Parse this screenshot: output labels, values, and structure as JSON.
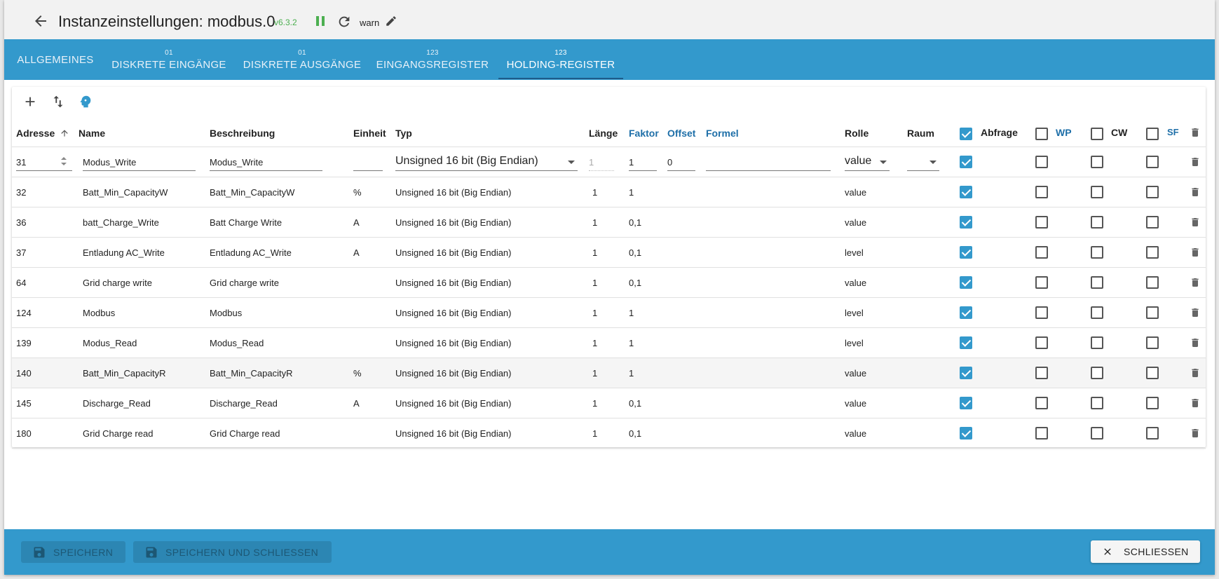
{
  "header": {
    "title": "Instanzeinstellungen: modbus.0",
    "version": "v6.3.2",
    "log_level": "warn"
  },
  "tabs": [
    {
      "sup": "",
      "label": "ALLGEMEINES"
    },
    {
      "sup": "01",
      "label": "DISKRETE EINGÄNGE"
    },
    {
      "sup": "01",
      "label": "DISKRETE AUSGÄNGE"
    },
    {
      "sup": "123",
      "label": "EINGANGSREGISTER"
    },
    {
      "sup": "123",
      "label": "HOLDING-REGISTER"
    }
  ],
  "active_tab": "HOLDING-REGISTER",
  "columns": {
    "address": "Adresse",
    "name": "Name",
    "description": "Beschreibung",
    "unit": "Einheit",
    "type": "Typ",
    "length": "Länge",
    "factor": "Faktor",
    "offset": "Offset",
    "formula": "Formel",
    "role": "Rolle",
    "room": "Raum",
    "poll": "Abfrage",
    "wp": "WP",
    "cw": "CW",
    "sf": "SF"
  },
  "edit_row": {
    "address": "31",
    "name": "Modus_Write",
    "description": "Modus_Write",
    "unit": "",
    "type": "Unsigned 16 bit (Big Endian)",
    "length": "1",
    "factor": "1",
    "offset": "0",
    "formula": "",
    "role": "value",
    "room": "",
    "poll": true,
    "wp": false,
    "cw": false,
    "sf": false
  },
  "rows": [
    {
      "address": "32",
      "name": "Batt_Min_CapacityW",
      "description": "Batt_Min_CapacityW",
      "unit": "%",
      "type": "Unsigned 16 bit (Big Endian)",
      "length": "1",
      "factor": "1",
      "role": "value",
      "poll": true,
      "wp": false,
      "cw": false,
      "sf": false
    },
    {
      "address": "36",
      "name": "batt_Charge_Write",
      "description": "Batt Charge Write",
      "unit": "A",
      "type": "Unsigned 16 bit (Big Endian)",
      "length": "1",
      "factor": "0,1",
      "role": "value",
      "poll": true,
      "wp": false,
      "cw": false,
      "sf": false
    },
    {
      "address": "37",
      "name": "Entladung AC_Write",
      "description": "Entladung AC_Write",
      "unit": "A",
      "type": "Unsigned 16 bit (Big Endian)",
      "length": "1",
      "factor": "0,1",
      "role": "level",
      "poll": true,
      "wp": false,
      "cw": false,
      "sf": false
    },
    {
      "address": "64",
      "name": "Grid charge write",
      "description": "Grid charge write",
      "unit": "",
      "type": "Unsigned 16 bit (Big Endian)",
      "length": "1",
      "factor": "0,1",
      "role": "value",
      "poll": true,
      "wp": false,
      "cw": false,
      "sf": false
    },
    {
      "address": "124",
      "name": "Modbus",
      "description": "Modbus",
      "unit": "",
      "type": "Unsigned 16 bit (Big Endian)",
      "length": "1",
      "factor": "1",
      "role": "level",
      "poll": true,
      "wp": false,
      "cw": false,
      "sf": false
    },
    {
      "address": "139",
      "name": "Modus_Read",
      "description": "Modus_Read",
      "unit": "",
      "type": "Unsigned 16 bit (Big Endian)",
      "length": "1",
      "factor": "1",
      "role": "level",
      "poll": true,
      "wp": false,
      "cw": false,
      "sf": false
    },
    {
      "address": "140",
      "name": "Batt_Min_CapacityR",
      "description": "Batt_Min_CapacityR",
      "unit": "%",
      "type": "Unsigned 16 bit (Big Endian)",
      "length": "1",
      "factor": "1",
      "role": "value",
      "poll": true,
      "wp": false,
      "cw": false,
      "sf": false
    },
    {
      "address": "145",
      "name": "Discharge_Read",
      "description": "Discharge_Read",
      "unit": "A",
      "type": "Unsigned 16 bit (Big Endian)",
      "length": "1",
      "factor": "0,1",
      "role": "value",
      "poll": true,
      "wp": false,
      "cw": false,
      "sf": false
    },
    {
      "address": "180",
      "name": "Grid Charge read",
      "description": "Grid Charge read",
      "unit": "",
      "type": "Unsigned 16 bit (Big Endian)",
      "length": "1",
      "factor": "0,1",
      "role": "value",
      "poll": true,
      "wp": false,
      "cw": false,
      "sf": false
    }
  ],
  "footer": {
    "save": "SPEICHERN",
    "save_close": "SPEICHERN UND SCHLIESSEN",
    "close": "SCHLIESSEN"
  },
  "colors": {
    "accent": "#3399cc",
    "version_green": "#4caf50",
    "header_link_blue": "#1e6fa8"
  }
}
